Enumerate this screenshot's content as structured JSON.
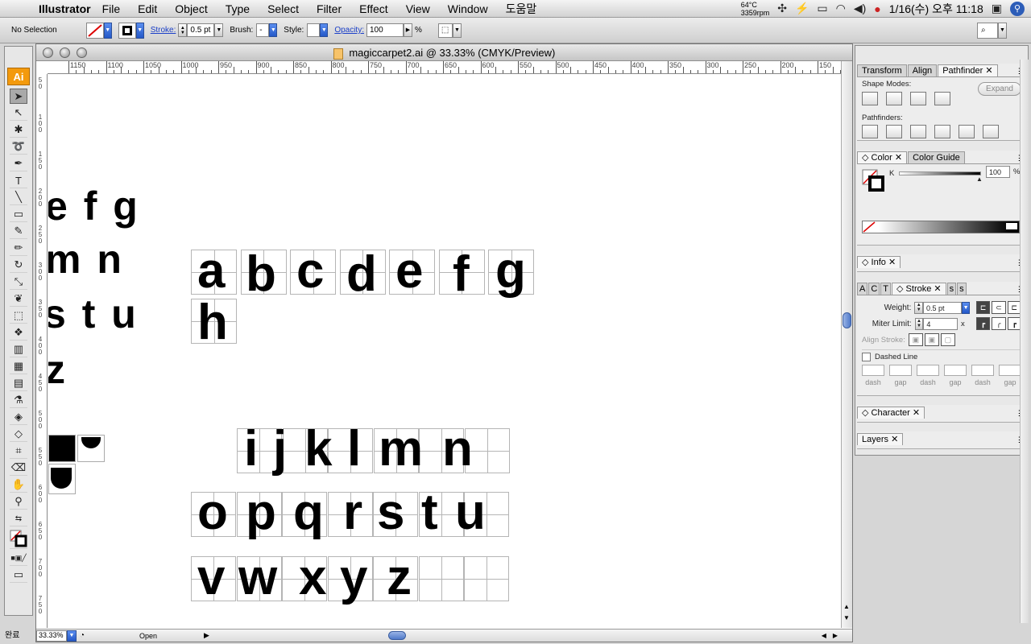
{
  "menubar": {
    "app_name": "Illustrator",
    "items": [
      "File",
      "Edit",
      "Object",
      "Type",
      "Select",
      "Filter",
      "Effect",
      "View",
      "Window",
      "도움말"
    ],
    "temp": "64°C",
    "rpm": "3359rpm",
    "clock": "1/16(수) 오후 11:18"
  },
  "options": {
    "selection": "No Selection",
    "stroke_label": "Stroke:",
    "stroke_value": "0.5 pt",
    "brush_label": "Brush:",
    "brush_value": "-",
    "style_label": "Style:",
    "opacity_label": "Opacity:",
    "opacity_value": "100",
    "percent": "%"
  },
  "document": {
    "title": "magiccarpet2.ai @ 33.33% (CMYK/Preview)",
    "zoom": "33.33%",
    "status": "Open",
    "hruler_labels": [
      "1150",
      "1100",
      "1050",
      "1000",
      "950",
      "900",
      "850",
      "800",
      "750",
      "700",
      "650",
      "600",
      "550",
      "500",
      "450",
      "400",
      "350",
      "300",
      "250",
      "200",
      "150"
    ],
    "vruler_labels": [
      "50",
      "100",
      "150",
      "200",
      "250",
      "300",
      "350",
      "400",
      "450",
      "500",
      "550",
      "600",
      "650",
      "700",
      "750"
    ]
  },
  "canvas": {
    "partial_left": [
      "e f g",
      "m n",
      "s t u",
      "z"
    ],
    "row1": [
      "a",
      "b",
      "c",
      "d",
      "e",
      "f",
      "g"
    ],
    "row1b": [
      "h"
    ],
    "row2": [
      "i",
      "j",
      "k",
      "l",
      "m",
      "n"
    ],
    "row3": [
      "o",
      "p",
      "q",
      "r",
      "s",
      "t",
      "u"
    ],
    "row4": [
      "v",
      "w",
      "x",
      "y",
      "z"
    ]
  },
  "panels": {
    "pathfinder_tabs": [
      "Transform",
      "Align",
      "Pathfinder"
    ],
    "shape_modes": "Shape Modes:",
    "expand": "Expand",
    "pathfinders": "Pathfinders:",
    "color_tabs": [
      "Color",
      "Color Guide"
    ],
    "color_k": "K",
    "color_value": "100",
    "info": "Info",
    "stroke_tabs": [
      "A",
      "C",
      "T",
      "Stroke",
      "s",
      "s"
    ],
    "weight_label": "Weight:",
    "weight_value": "0.5 pt",
    "miter_label": "Miter Limit:",
    "miter_value": "4",
    "miter_unit": "x",
    "align_label": "Align Stroke:",
    "dashed_label": "Dashed Line",
    "dash_labels": [
      "dash",
      "gap",
      "dash",
      "gap",
      "dash",
      "gap"
    ],
    "character": "Character",
    "layers": "Layers"
  },
  "status_left": "완료"
}
